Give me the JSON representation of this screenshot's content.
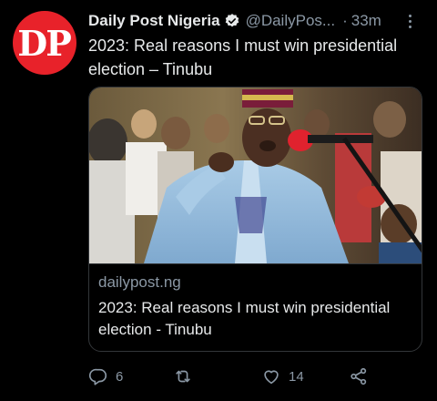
{
  "avatar": {
    "text": "DP",
    "color": "#e8222a"
  },
  "author": {
    "display_name": "Daily Post Nigeria",
    "handle": "@DailyPos...",
    "separator": "·",
    "time": "33m",
    "verified": true
  },
  "tweet": {
    "text": "2023: Real reasons I must win presidential election – Tinubu"
  },
  "card": {
    "domain": "dailypost.ng",
    "title": "2023: Real reasons I must win presidential election - Tinubu"
  },
  "actions": {
    "reply_count": "6",
    "retweet_count": "",
    "like_count": "14"
  },
  "icons": {
    "verified": "verified-badge-icon",
    "more": "more-options-icon",
    "reply": "reply-icon",
    "retweet": "retweet-icon",
    "like": "heart-icon",
    "share": "share-icon"
  },
  "colors": {
    "background": "#000000",
    "text_primary": "#e7e9ea",
    "text_secondary": "#8b98a5",
    "border": "#333639"
  }
}
